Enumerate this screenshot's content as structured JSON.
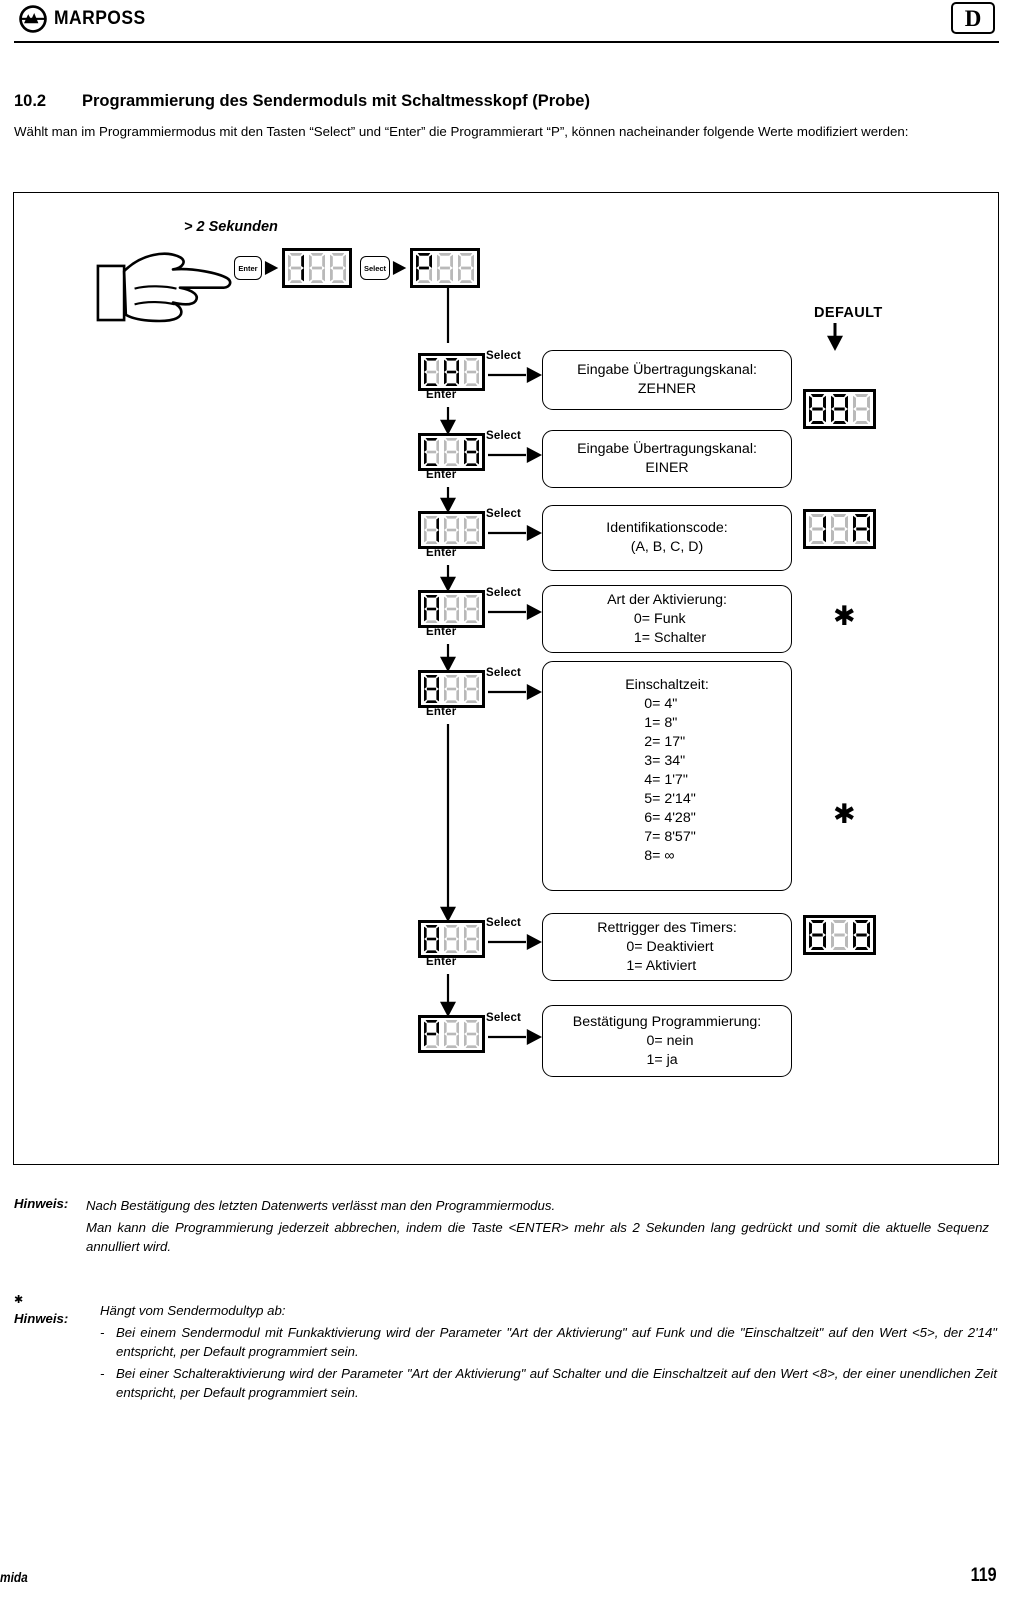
{
  "header": {
    "brand": "MARPOSS",
    "language_badge": "D"
  },
  "section": {
    "number": "10.2",
    "title": "Programmierung des Sendermoduls mit Schaltmesskopf (Probe)",
    "intro": "Wählt man im Programmiermodus mit den Tasten “Select” und “Enter” die Programmierart “P”, können nacheinander folgende Werte modifiziert werden:"
  },
  "diagram": {
    "hold_label": "> 2 Sekunden",
    "default_label": "DEFAULT",
    "enter_key": "Enter",
    "select_key": "Select",
    "enter_arrow": "Enter",
    "select_arrow": "Select",
    "star": "✱",
    "start_sequence": [
      {
        "display": "I88",
        "segments": [
          "1",
          "8-off",
          "8-off"
        ]
      },
      {
        "display": "P88",
        "segments": [
          "P",
          "8-off",
          "8-off"
        ]
      }
    ],
    "steps": [
      {
        "display_segments": [
          "C",
          "8-blink",
          "8-off"
        ],
        "head": "Eingabe Übertragungskanal:",
        "sub": "ZEHNER",
        "options": [],
        "default_segments": [
          "8",
          "8",
          "8-off"
        ],
        "has_default": true,
        "star": false
      },
      {
        "display_segments": [
          "C",
          "8-off",
          "8-blink"
        ],
        "head": "Eingabe Übertragungskanal:",
        "sub": "EINER",
        "options": [],
        "has_default": false,
        "star": false
      },
      {
        "display_segments": [
          "1",
          "8-off",
          "8-off"
        ],
        "head": "Identifikationscode:",
        "sub": "(A, B, C, D)",
        "options": [],
        "default_segments": [
          "1",
          "8-off",
          "A"
        ],
        "has_default": true,
        "star": false
      },
      {
        "display_segments": [
          "A",
          "8-off",
          "8-off"
        ],
        "head": "Art der Aktivierung:",
        "sub": "",
        "options": [
          "0= Funk",
          "1= Schalter"
        ],
        "has_default": false,
        "star": true
      },
      {
        "display_segments": [
          "8",
          "8-off",
          "8-off"
        ],
        "head": "Einschaltzeit:",
        "sub": "",
        "options": [
          "0= 4\"",
          "1= 8\"",
          "2= 17\"",
          "3= 34\"",
          "4= 1'7\"",
          "5= 2'14\"",
          "6= 4'28\"",
          "7= 8'57\"",
          "8= ∞"
        ],
        "has_default": false,
        "star": true
      },
      {
        "display_segments": [
          "8",
          "8-off",
          "8-off"
        ],
        "head": "Rettrigger des Timers:",
        "sub": "",
        "options": [
          "0= Deaktiviert",
          "1= Aktiviert"
        ],
        "default_segments": [
          "8",
          "8-off",
          "8"
        ],
        "has_default": true,
        "star": false
      },
      {
        "display_segments": [
          "P",
          "8-off",
          "8-off"
        ],
        "head": "Bestätigung Programmierung:",
        "sub": "",
        "options": [
          "0= nein",
          "1= ja"
        ],
        "has_default": false,
        "star": false
      }
    ]
  },
  "notes": {
    "tag": "Hinweis:",
    "line1": "Nach Bestätigung des letzten Datenwerts verlässt man den Programmiermodus.",
    "line2": "Man kann die Programmierung jederzeit abbrechen, indem die Taste <ENTER> mehr als 2 Sekunden lang gedrückt und somit die aktuelle Sequenz annulliert wird."
  },
  "note_star": {
    "marker": "✱",
    "tag": "Hinweis:",
    "lead": "Hängt vom Sendermodultyp ab:",
    "dash": "-",
    "bullets": [
      "Bei einem Sendermodul mit Funkaktivierung wird der Parameter \"Art der Aktivierung\" auf Funk und die \"Einschaltzeit\" auf den Wert <5>, der  2'14\" entspricht, per Default programmiert sein.",
      "Bei einer Schalteraktivierung wird der Parameter \"Art der Aktivierung\" auf Schalter und die Einschaltzeit auf den Wert <8>, der einer unendlichen Zeit entspricht, per Default programmiert sein."
    ]
  },
  "footer": {
    "left": "mida",
    "page": "119"
  },
  "colors": {
    "ink": "#000000",
    "segment_on": "#000000",
    "segment_off": "#b9b9b9"
  }
}
